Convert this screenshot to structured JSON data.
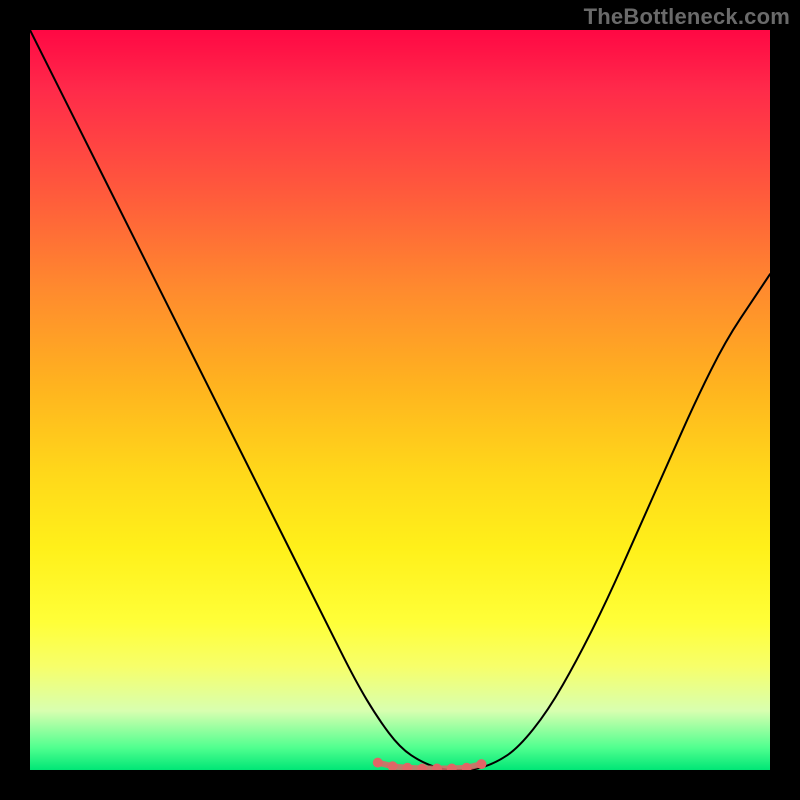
{
  "watermark": "TheBottleneck.com",
  "chart_data": {
    "type": "line",
    "title": "",
    "xlabel": "",
    "ylabel": "",
    "xlim": [
      0,
      100
    ],
    "ylim": [
      0,
      100
    ],
    "grid": false,
    "legend": false,
    "background_gradient": {
      "top": "#ff0844",
      "middle": "#ffd81a",
      "bottom": "#00e676"
    },
    "series": [
      {
        "name": "bottleneck-curve",
        "stroke": "#000000",
        "x": [
          0,
          2,
          5,
          8,
          12,
          16,
          20,
          25,
          30,
          35,
          40,
          44,
          47,
          50,
          53,
          56,
          58,
          60,
          63,
          66,
          70,
          74,
          78,
          82,
          86,
          90,
          94,
          98,
          100
        ],
        "values": [
          100,
          96,
          90,
          84,
          76,
          68,
          60,
          50,
          40,
          30,
          20,
          12,
          7,
          3,
          1,
          0,
          0,
          0,
          1,
          3,
          8,
          15,
          23,
          32,
          41,
          50,
          58,
          64,
          67
        ]
      },
      {
        "name": "optimal-range-dots",
        "type": "scatter",
        "color": "#e06666",
        "x": [
          47,
          49,
          51,
          53,
          55,
          57,
          59,
          61
        ],
        "values": [
          1.0,
          0.5,
          0.3,
          0.2,
          0.2,
          0.2,
          0.3,
          0.8
        ]
      }
    ]
  }
}
